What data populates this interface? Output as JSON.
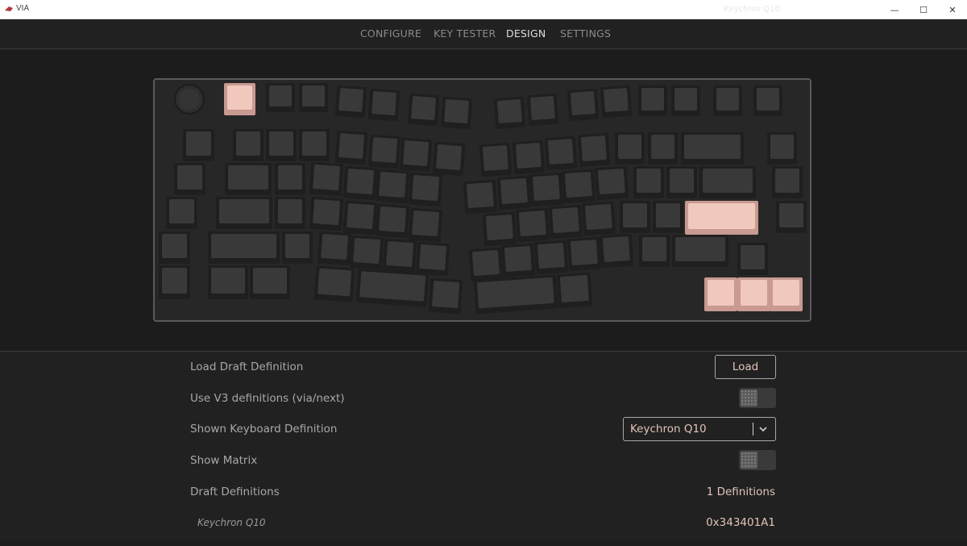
{
  "window": {
    "title": "VIA",
    "ghost_title": "Keychron Q10",
    "controls": {
      "minimize": "—",
      "maximize": "☐",
      "close": "✕"
    }
  },
  "nav": {
    "items": [
      {
        "label": "CONFIGURE",
        "active": false
      },
      {
        "label": "KEY TESTER",
        "active": false
      },
      {
        "label": "DESIGN",
        "active": true
      },
      {
        "label": "SETTINGS",
        "active": false
      }
    ]
  },
  "colors": {
    "background": "#212121",
    "accent": "#e2c4b8",
    "key_highlight": "#f0c8bc",
    "key": "#393939"
  },
  "design": {
    "load_draft": {
      "label": "Load Draft Definition",
      "button": "Load"
    },
    "use_v3": {
      "label": "Use V3 definitions (via/next)",
      "enabled": false
    },
    "shown_definition": {
      "label": "Shown Keyboard Definition",
      "value": "Keychron Q10",
      "dropdown_icon": "chevron-down-icon"
    },
    "show_matrix": {
      "label": "Show Matrix",
      "enabled": false
    },
    "draft_definitions": {
      "label": "Draft Definitions",
      "value": "1 Definitions"
    },
    "definitions": [
      {
        "name": "Keychron Q10",
        "id": "0x343401A1"
      }
    ]
  }
}
